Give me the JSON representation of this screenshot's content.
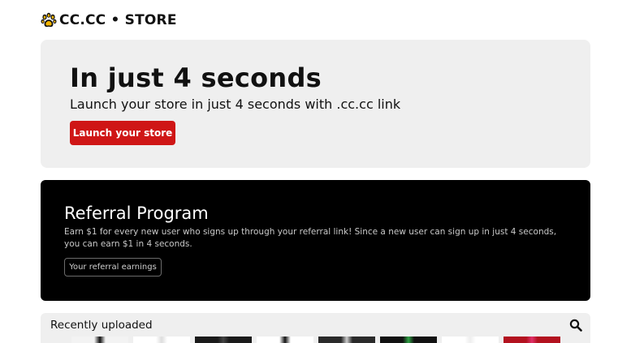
{
  "brand": {
    "logo_icon": "paw-icon",
    "name": "CC.CC • STORE"
  },
  "hero": {
    "title": "In just 4 seconds",
    "subtitle": "Launch your store in just 4 seconds with .cc.cc link",
    "button_label": "Launch your store",
    "button_color": "#cf1616"
  },
  "referral": {
    "title": "Referral Program",
    "description": "Earn $1 for every new user who signs up through your referral link! Since a new user can sign up in just 4 seconds, you can earn $1 in 4 seconds.",
    "button_label": "Your referral earnings"
  },
  "recent": {
    "title": "Recently uploaded",
    "search_icon": "search-icon",
    "thumbnails": [
      {
        "color": "#f3f3f3",
        "accent": "#111111"
      },
      {
        "color": "#ffffff",
        "accent": "#dddddd"
      },
      {
        "color": "#1a1a1a",
        "accent": "#444444"
      },
      {
        "color": "#ffffff",
        "accent": "#111111"
      },
      {
        "color": "#2a2a2a",
        "accent": "#cccccc"
      },
      {
        "color": "#111111",
        "accent": "#2ea043"
      },
      {
        "color": "#ffffff",
        "accent": "#eeeeee"
      },
      {
        "color": "#b3121f",
        "accent": "#e0306a"
      }
    ]
  }
}
